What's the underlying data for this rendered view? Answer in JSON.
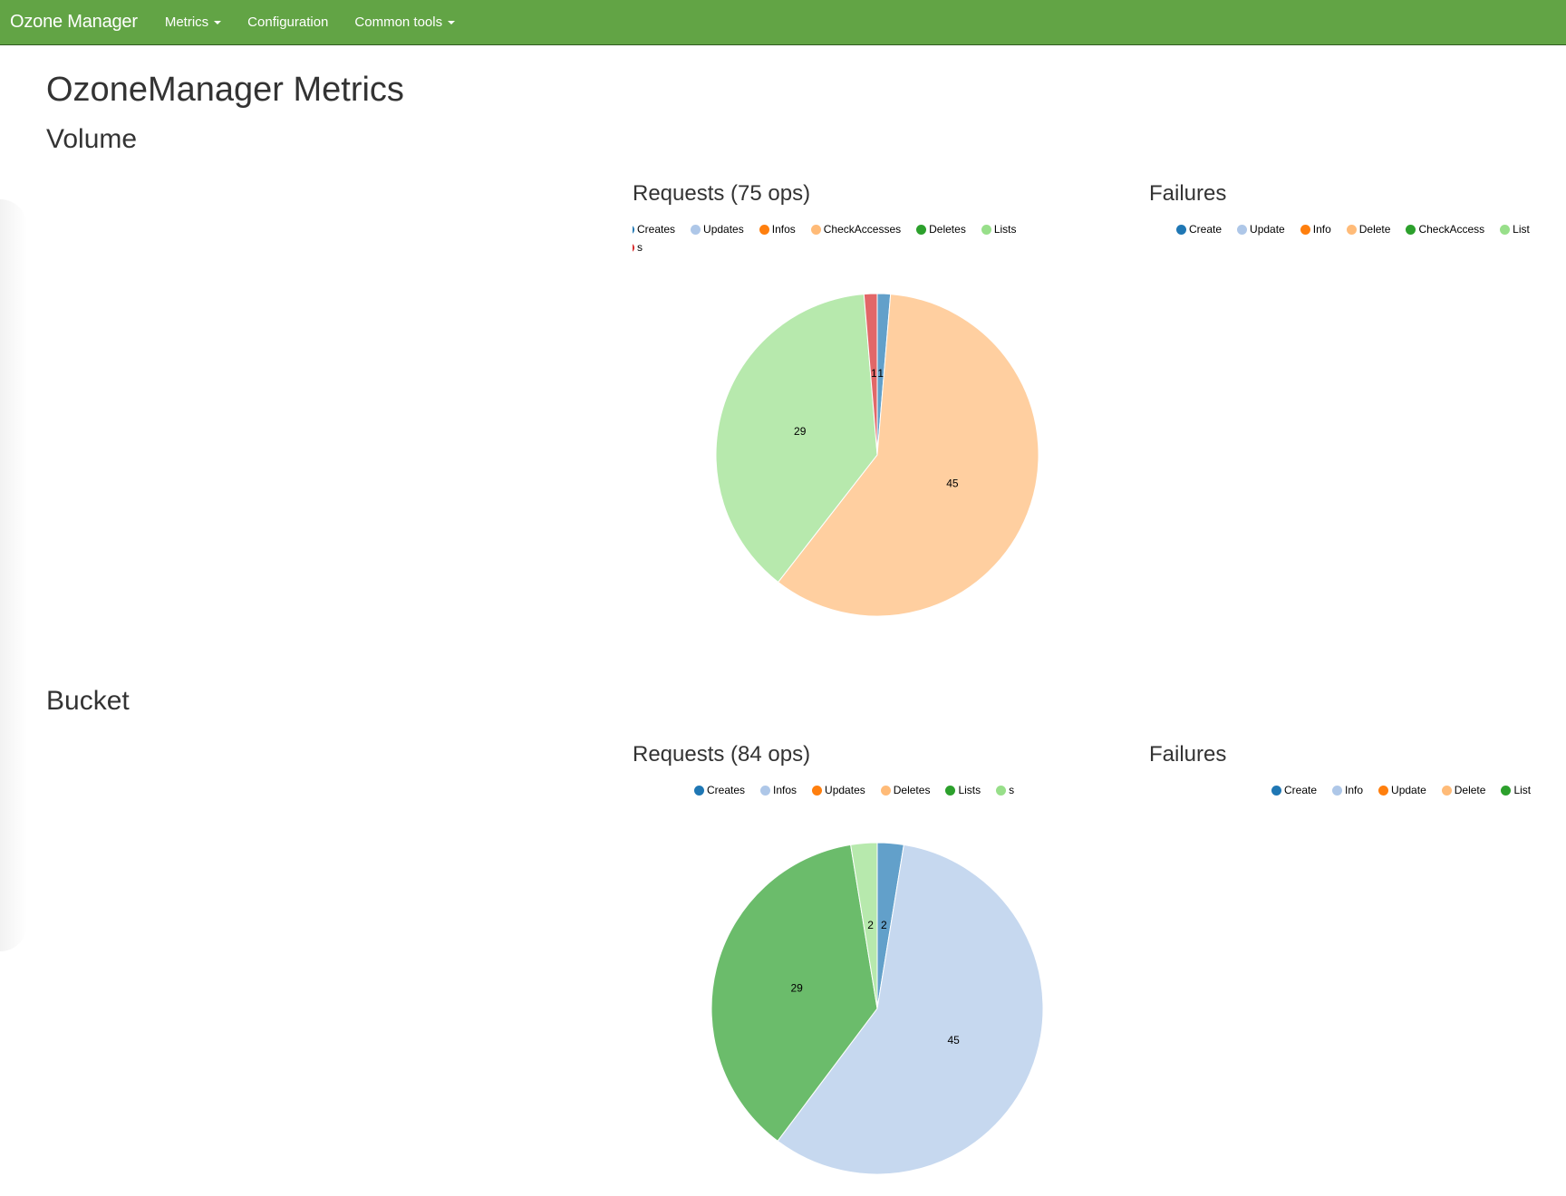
{
  "navbar": {
    "brand": "Ozone Manager",
    "items": [
      {
        "label": "Metrics",
        "dropdown": true
      },
      {
        "label": "Configuration",
        "dropdown": false
      },
      {
        "label": "Common tools",
        "dropdown": true
      }
    ],
    "background_color": "#62a445"
  },
  "page_title": "OzoneManager Metrics",
  "volume": {
    "heading": "Volume",
    "requests_title": "Requests (75 ops)",
    "requests_legend": [
      "Creates",
      "Updates",
      "Infos",
      "CheckAccesses",
      "Deletes",
      "Lists",
      "s"
    ],
    "failures_title": "Failures",
    "failures_legend": [
      "Create",
      "Update",
      "Info",
      "Delete",
      "CheckAccess",
      "List"
    ]
  },
  "bucket": {
    "heading": "Bucket",
    "requests_title": "Requests (84 ops)",
    "requests_legend": [
      "Creates",
      "Infos",
      "Updates",
      "Deletes",
      "Lists",
      "s"
    ],
    "failures_title": "Failures",
    "failures_legend": [
      "Create",
      "Info",
      "Update",
      "Delete",
      "List"
    ]
  },
  "palette": [
    "#1f77b4",
    "#aec7e8",
    "#ff7f0e",
    "#ffbb78",
    "#2ca02c",
    "#98df8a",
    "#d62728"
  ],
  "chart_data": [
    {
      "type": "pie",
      "title": "Requests (75 ops)",
      "slices": [
        {
          "label": "Creates",
          "value": 1,
          "color": "#1f77b4",
          "display": "1"
        },
        {
          "label": "Updates",
          "value": 0,
          "color": "#aec7e8",
          "display": ""
        },
        {
          "label": "Infos",
          "value": 0,
          "color": "#ff7f0e",
          "display": ""
        },
        {
          "label": "CheckAccesses",
          "value": 45,
          "color": "#ffbb78",
          "display": "45"
        },
        {
          "label": "Deletes",
          "value": 0,
          "color": "#2ca02c",
          "display": ""
        },
        {
          "label": "Lists",
          "value": 29,
          "color": "#98df8a",
          "display": "29"
        },
        {
          "label": "s",
          "value": 1,
          "color": "#d62728",
          "display": "1"
        }
      ]
    },
    {
      "type": "pie",
      "title": "Failures",
      "slices": [
        {
          "label": "Create",
          "value": 0,
          "color": "#1f77b4"
        },
        {
          "label": "Update",
          "value": 0,
          "color": "#aec7e8"
        },
        {
          "label": "Info",
          "value": 0,
          "color": "#ff7f0e"
        },
        {
          "label": "Delete",
          "value": 0,
          "color": "#ffbb78"
        },
        {
          "label": "CheckAccess",
          "value": 0,
          "color": "#2ca02c"
        },
        {
          "label": "List",
          "value": 0,
          "color": "#98df8a"
        }
      ]
    },
    {
      "type": "pie",
      "title": "Requests (84 ops)",
      "slices": [
        {
          "label": "Creates",
          "value": 2,
          "color": "#1f77b4",
          "display": "2"
        },
        {
          "label": "Infos",
          "value": 45,
          "color": "#aec7e8",
          "display": "45"
        },
        {
          "label": "Updates",
          "value": 0,
          "color": "#ff7f0e",
          "display": ""
        },
        {
          "label": "Deletes",
          "value": 0,
          "color": "#ffbb78",
          "display": ""
        },
        {
          "label": "Lists",
          "value": 29,
          "color": "#2ca02c",
          "display": "29"
        },
        {
          "label": "s",
          "value": 2,
          "color": "#98df8a",
          "display": "2"
        }
      ]
    },
    {
      "type": "pie",
      "title": "Failures",
      "slices": [
        {
          "label": "Create",
          "value": 0,
          "color": "#1f77b4"
        },
        {
          "label": "Info",
          "value": 0,
          "color": "#aec7e8"
        },
        {
          "label": "Update",
          "value": 0,
          "color": "#ff7f0e"
        },
        {
          "label": "Delete",
          "value": 0,
          "color": "#ffbb78"
        },
        {
          "label": "List",
          "value": 0,
          "color": "#2ca02c"
        }
      ]
    }
  ]
}
